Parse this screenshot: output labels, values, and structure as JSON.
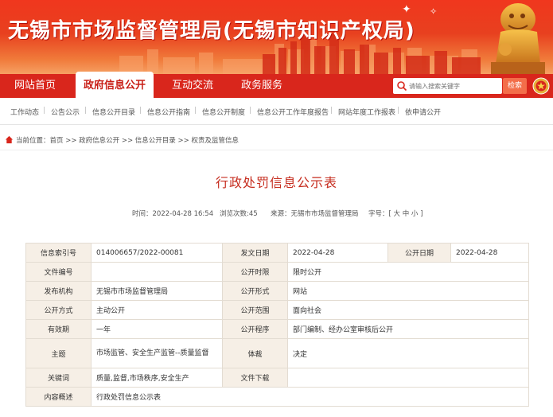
{
  "banner": {
    "title": "无锡市市场监督管理局(无锡市知识产权局)"
  },
  "nav": {
    "items": [
      {
        "label": "网站首页"
      },
      {
        "label": "政府信息公开"
      },
      {
        "label": "互动交流"
      },
      {
        "label": "政务服务"
      }
    ],
    "search_placeholder": "请输入搜索关键字",
    "search_button": "检索"
  },
  "subnav": {
    "items": [
      "工作动态",
      "公告公示",
      "信息公开目录",
      "信息公开指南",
      "信息公开制度",
      "信息公开工作年度报告",
      "网站年度工作报表",
      "依申请公开"
    ]
  },
  "breadcrumb": {
    "text": "当前位置：首页 >> 政府信息公开 >> 信息公开目录 >> 权责及监管信息"
  },
  "page": {
    "title": "行政处罚信息公示表",
    "meta_time": "时间：2022-04-28 16:54",
    "meta_views": "浏览次数:45",
    "meta_source": "来源：无锡市市场监督管理局",
    "meta_fontsize": "字号：[ 大 中 小 ]"
  },
  "table": {
    "index_label": "信息索引号",
    "index_value": "014006657/2022-00081",
    "issue_date_label": "发文日期",
    "issue_date_value": "2022-04-28",
    "public_date_label": "公开日期",
    "public_date_value": "2022-04-28",
    "doc_no_label": "文件编号",
    "doc_no_value": "",
    "time_limit_label": "公开时限",
    "time_limit_value": "限时公开",
    "publisher_label": "发布机构",
    "publisher_value": "无锡市市场监督管理局",
    "form_label": "公开形式",
    "form_value": "网站",
    "method_label": "公开方式",
    "method_value": "主动公开",
    "scope_label": "公开范围",
    "scope_value": "面向社会",
    "validity_label": "有效期",
    "validity_value": "一年",
    "procedure_label": "公开程序",
    "procedure_value": "部门编制、经办公室审核后公开",
    "topic_label": "主题",
    "topic_value": "市场监管、安全生产监管--质量监督",
    "genre_label": "体裁",
    "genre_value": "决定",
    "keywords_label": "关键词",
    "keywords_value": "质量,监督,市场秩序,安全生产",
    "download_label": "文件下载",
    "download_value": "",
    "summary_label": "内容概述",
    "summary_value": "行政处罚信息公示表"
  },
  "colors": {
    "banner_red": "#e8401f",
    "nav_red": "#d9261c",
    "title_red": "#c62d1f",
    "label_bg": "#f6efe6"
  }
}
